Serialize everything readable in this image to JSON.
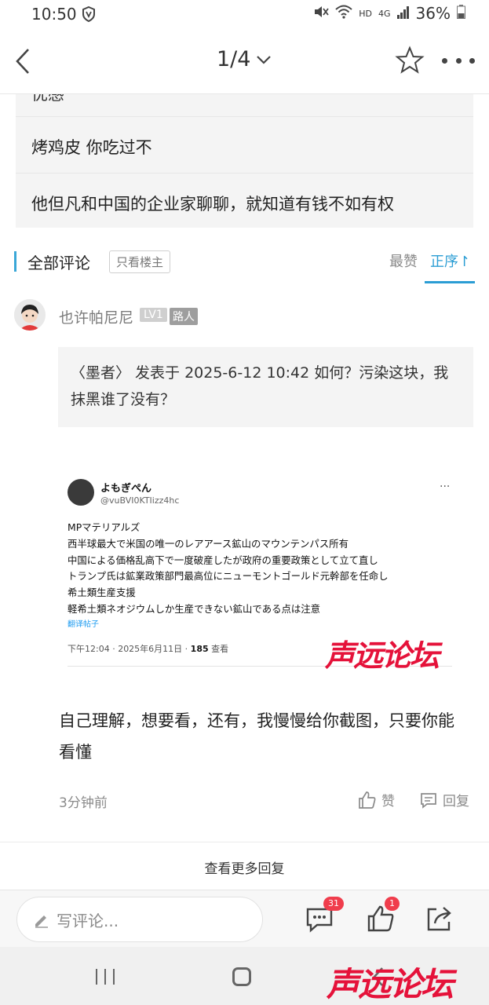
{
  "status_bar": {
    "time": "10:50",
    "network": "HD",
    "signal": "4G",
    "battery": "36%"
  },
  "top_bar": {
    "page_indicator": "1/4"
  },
  "quoted_post": {
    "cut_line": "优感",
    "lines": [
      "烤鸡皮 你吃过不",
      "他但凡和中国的企业家聊聊，就知道有钱不如有权"
    ]
  },
  "comments_header": {
    "title": "全部评论",
    "op_only": "只看楼主",
    "sort_likes": "最赞",
    "sort_order": "正序↾"
  },
  "comment": {
    "username": "也许帕尼尼",
    "level": "LV1",
    "rank": "路人",
    "quote": "〈墨者〉 发表于 2025-6-12 10:42 如何？污染这块，我抹黑谁了没有？",
    "embed": {
      "name": "よもぎぺん",
      "handle": "@vuBVI0KTIizz4hc",
      "more": "···",
      "lines": [
        "MPマテリアルズ",
        "西半球最大で米国の唯一のレアアース鉱山のマウンテンパス所有",
        "中国による価格乱高下で一度破産したが政府の重要政策として立て直し",
        "トランプ氏は鉱業政策部門最高位にニューモントゴールド元幹部を任命し",
        "希土類生産支援",
        "軽希土類ネオジウムしか生産できない鉱山である点は注意"
      ],
      "translate": "翻译帖子",
      "meta_prefix": "下午12:04 · 2025年6月11日 · ",
      "views": "185",
      "views_suffix": " 查看",
      "watermark": "声远论坛"
    },
    "reply_text": "自己理解，想要看，还有，我慢慢给你截图，只要你能看懂",
    "time_ago": "3分钟前",
    "like_label": "赞",
    "reply_label": "回复"
  },
  "more_replies": "查看更多回复",
  "bottom_bar": {
    "comment_placeholder": "写评论...",
    "comment_count": "31",
    "like_count": "1"
  },
  "page_watermark": "声远论坛",
  "colors": {
    "accent": "#2b9dd4",
    "badge_red": "#f03d4c",
    "watermark_red": "#e5123a"
  }
}
